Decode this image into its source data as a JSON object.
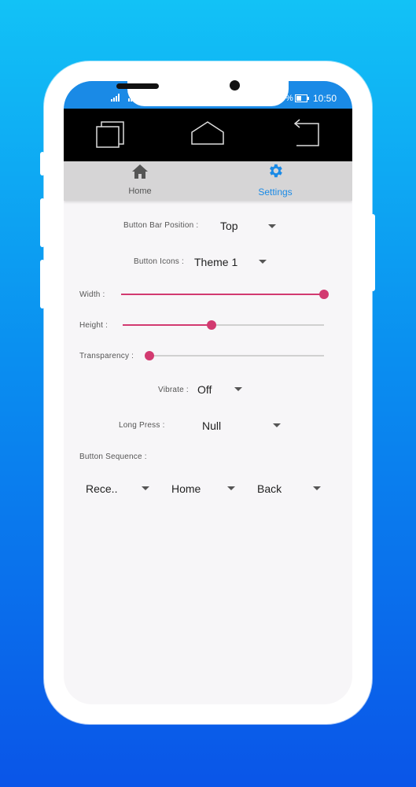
{
  "status_bar": {
    "battery": "%",
    "time": "10:50"
  },
  "tabs": [
    {
      "label": "Home",
      "color": "#555555",
      "icon": "home-icon"
    },
    {
      "label": "Settings",
      "color": "#1a8ae6",
      "icon": "gear-icon"
    }
  ],
  "settings": {
    "bar_position": {
      "label": "Button Bar Position :",
      "value": "Top"
    },
    "button_icons": {
      "label": "Button Icons :",
      "value": "Theme 1"
    },
    "width": {
      "label": "Width :",
      "value_percent": 100
    },
    "height": {
      "label": "Height :",
      "value_percent": 44
    },
    "transparency": {
      "label": "Transparency :",
      "value_percent": 0
    },
    "vibrate": {
      "label": "Vibrate :",
      "value": "Off"
    },
    "long_press": {
      "label": "Long Press :",
      "value": "Null"
    },
    "button_sequence": {
      "label": "Button Sequence :",
      "items": [
        "Rece..",
        "Home",
        "Back"
      ]
    }
  },
  "accent_color": "#d23a70"
}
